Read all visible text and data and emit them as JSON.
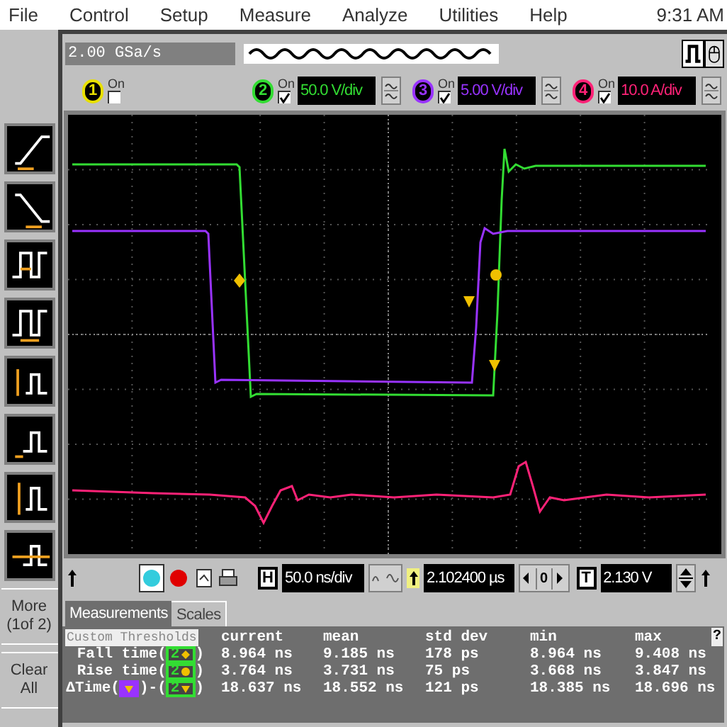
{
  "menu": [
    {
      "label": "File"
    },
    {
      "label": "Control"
    },
    {
      "label": "Setup"
    },
    {
      "label": "Measure"
    },
    {
      "label": "Analyze"
    },
    {
      "label": "Utilities"
    },
    {
      "label": "Help"
    }
  ],
  "clock": "9:31 AM",
  "sample_rate": "2.00 GSa/s",
  "channels": [
    {
      "number": "1",
      "on_label": "On",
      "on": false,
      "color": "#e8e000"
    },
    {
      "number": "2",
      "on_label": "On",
      "on": true,
      "scale": "50.0 V/div",
      "color": "#33dd33"
    },
    {
      "number": "3",
      "on_label": "On",
      "on": true,
      "scale": "5.00 V/div",
      "color": "#9933ff"
    },
    {
      "number": "4",
      "on_label": "On",
      "on": true,
      "scale": "10.0 A/div",
      "color": "#ff2277"
    }
  ],
  "tools": [
    {
      "kind": "rise"
    },
    {
      "kind": "fall"
    },
    {
      "kind": "width"
    },
    {
      "kind": "period"
    },
    {
      "kind": "amplitude"
    },
    {
      "kind": "base"
    },
    {
      "kind": "peak"
    },
    {
      "kind": "overshoot"
    }
  ],
  "more_button": [
    "More",
    "(1of 2)"
  ],
  "clear_button": [
    "Clear",
    "All"
  ],
  "horizontal": {
    "label": "H",
    "scale": "50.0 ns/div",
    "position": "2.102400 µs",
    "reference": "0"
  },
  "trigger": {
    "label": "T",
    "value": "2.130 V"
  },
  "tabs": [
    {
      "label": "Measurements",
      "selected": true
    },
    {
      "label": "Scales",
      "selected": false
    }
  ],
  "measurements": {
    "thresholds_button": "Custom Thresholds",
    "help": "?",
    "columns": [
      "current",
      "mean",
      "std dev",
      "min",
      "max"
    ],
    "rows": [
      {
        "name": "Fall time(",
        "sources": [
          {
            "channel": "2",
            "kind": "diamond",
            "color": "#33dd33",
            "after": ")"
          }
        ],
        "values": [
          "8.964 ns",
          "9.185 ns",
          "178 ps",
          "8.964 ns",
          "9.408 ns"
        ]
      },
      {
        "name": "Rise time(",
        "sources": [
          {
            "channel": "2",
            "kind": "circle",
            "color": "#33dd33",
            "after": ")"
          }
        ],
        "values": [
          "3.764 ns",
          "3.731 ns",
          "75 ps",
          "3.668 ns",
          "3.847 ns"
        ]
      },
      {
        "name": "ΔTime(",
        "sources": [
          {
            "kind": "triangle",
            "color": "#9933ff",
            "after": ")-("
          },
          {
            "channel": "2",
            "kind": "triangle",
            "color": "#33dd33",
            "after": ")"
          }
        ],
        "values": [
          "18.637 ns",
          "18.552 ns",
          "121 ps",
          "18.385 ns",
          "18.696 ns"
        ]
      }
    ]
  }
}
